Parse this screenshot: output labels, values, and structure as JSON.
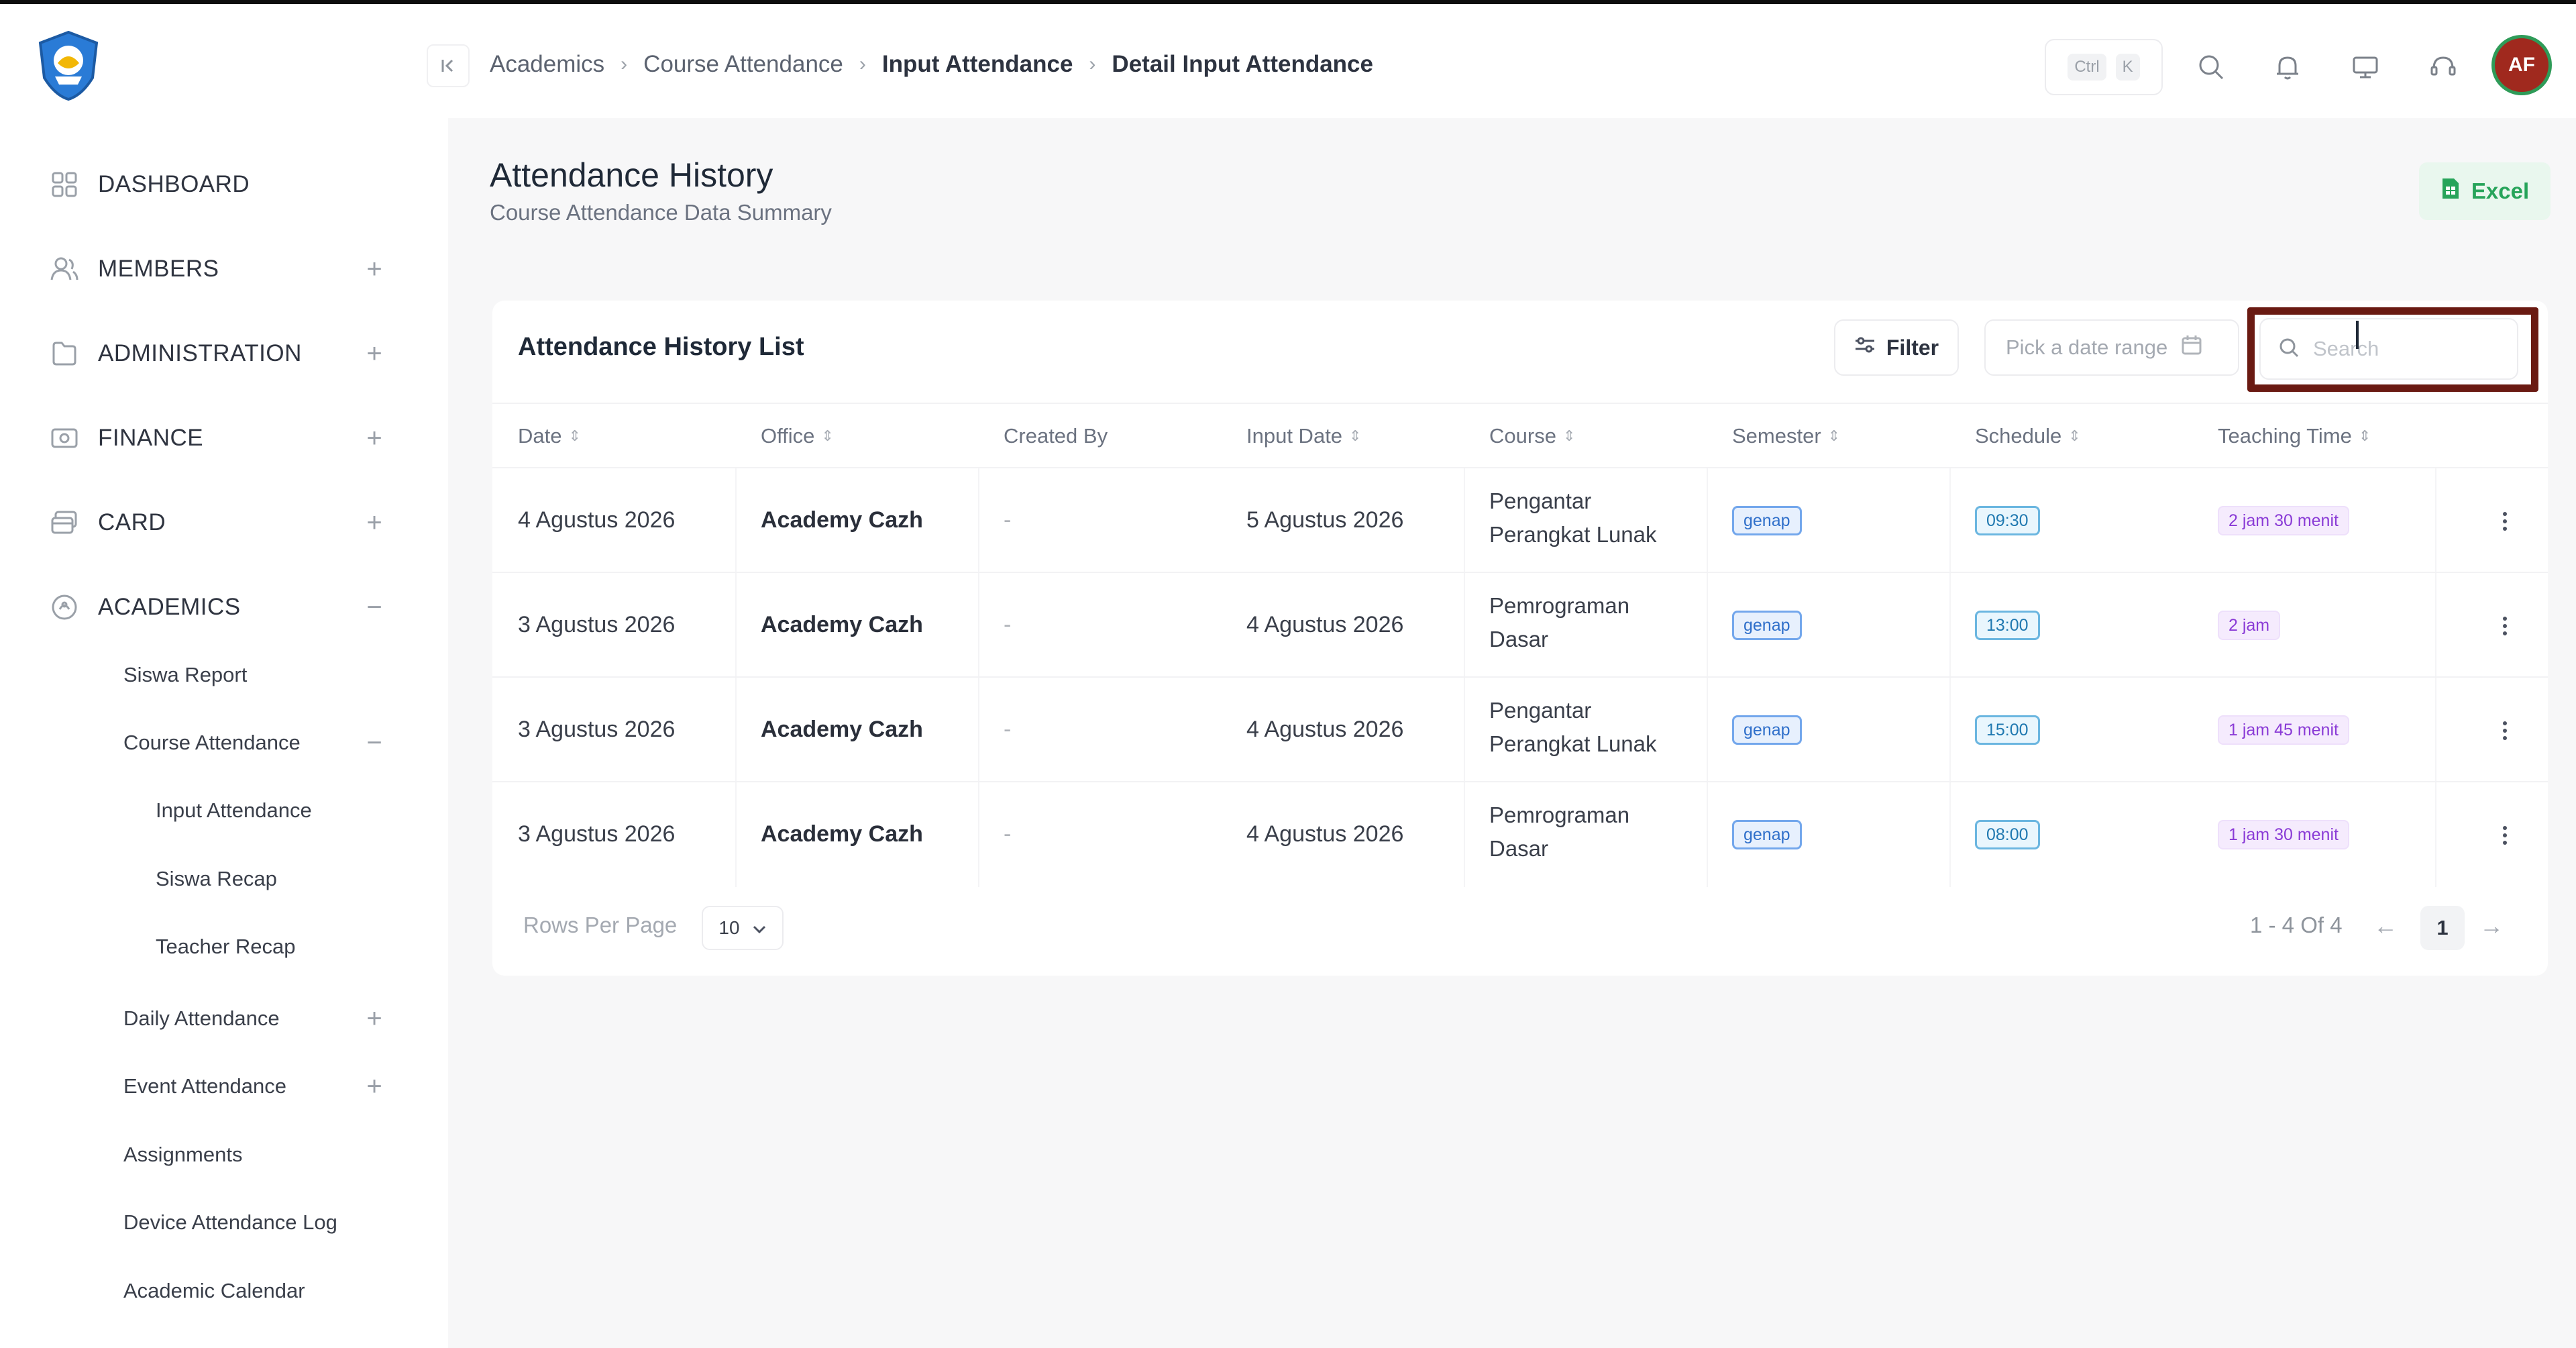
{
  "sidebar": {
    "items": [
      {
        "label": "DASHBOARD",
        "toggle": "",
        "icon": "grid-icon"
      },
      {
        "label": "MEMBERS",
        "toggle": "+",
        "icon": "users-icon"
      },
      {
        "label": "ADMINISTRATION",
        "toggle": "+",
        "icon": "folder-icon"
      },
      {
        "label": "FINANCE",
        "toggle": "+",
        "icon": "money-icon"
      },
      {
        "label": "CARD",
        "toggle": "+",
        "icon": "card-icon"
      },
      {
        "label": "ACADEMICS",
        "toggle": "−",
        "icon": "academic-icon"
      }
    ],
    "academics_sub": [
      {
        "label": "Siswa Report",
        "toggle": ""
      },
      {
        "label": "Course Attendance",
        "toggle": "−"
      },
      {
        "label": "Input Attendance",
        "toggle": ""
      },
      {
        "label": "Siswa Recap",
        "toggle": ""
      },
      {
        "label": "Teacher Recap",
        "toggle": ""
      },
      {
        "label": "Daily Attendance",
        "toggle": "+"
      },
      {
        "label": "Event Attendance",
        "toggle": "+"
      },
      {
        "label": "Assignments",
        "toggle": ""
      },
      {
        "label": "Device Attendance Log",
        "toggle": ""
      },
      {
        "label": "Academic Calendar",
        "toggle": ""
      }
    ]
  },
  "header": {
    "breadcrumb": [
      "Academics",
      "Course Attendance",
      "Input Attendance",
      "Detail Input Attendance"
    ],
    "shortcut": [
      "Ctrl",
      "K"
    ],
    "avatar_initials": "AF"
  },
  "page": {
    "title": "Attendance History",
    "subtitle": "Course Attendance Data Summary",
    "excel_label": "Excel"
  },
  "table": {
    "title": "Attendance History List",
    "filter_label": "Filter",
    "date_range_placeholder": "Pick a date range",
    "search_placeholder": "Search",
    "columns": [
      "Date",
      "Office",
      "Created By",
      "Input Date",
      "Course",
      "Semester",
      "Schedule",
      "Teaching Time"
    ],
    "rows": [
      {
        "date": "4 Agustus 2026",
        "office": "Academy Cazh",
        "created_by": "-",
        "input_date": "5 Agustus 2026",
        "course_1": "Pengantar",
        "course_2": "Perangkat Lunak",
        "semester": "genap",
        "schedule": "09:30",
        "teaching_time": "2 jam 30 menit"
      },
      {
        "date": "3 Agustus 2026",
        "office": "Academy Cazh",
        "created_by": "-",
        "input_date": "4 Agustus 2026",
        "course_1": "Pemrograman",
        "course_2": "Dasar",
        "semester": "genap",
        "schedule": "13:00",
        "teaching_time": "2 jam"
      },
      {
        "date": "3 Agustus 2026",
        "office": "Academy Cazh",
        "created_by": "-",
        "input_date": "4 Agustus 2026",
        "course_1": "Pengantar",
        "course_2": "Perangkat Lunak",
        "semester": "genap",
        "schedule": "15:00",
        "teaching_time": "1 jam 45 menit"
      },
      {
        "date": "3 Agustus 2026",
        "office": "Academy Cazh",
        "created_by": "-",
        "input_date": "4 Agustus 2026",
        "course_1": "Pemrograman",
        "course_2": "Dasar",
        "semester": "genap",
        "schedule": "08:00",
        "teaching_time": "1 jam 30 menit"
      }
    ],
    "rows_per_page_label": "Rows Per Page",
    "rows_per_page_value": "10",
    "range_text": "1 - 4 Of 4",
    "current_page": "1"
  },
  "colors": {
    "accent_highlight": "#6a1a12",
    "excel_green": "#27a45a",
    "avatar_bg": "#a0291e"
  }
}
